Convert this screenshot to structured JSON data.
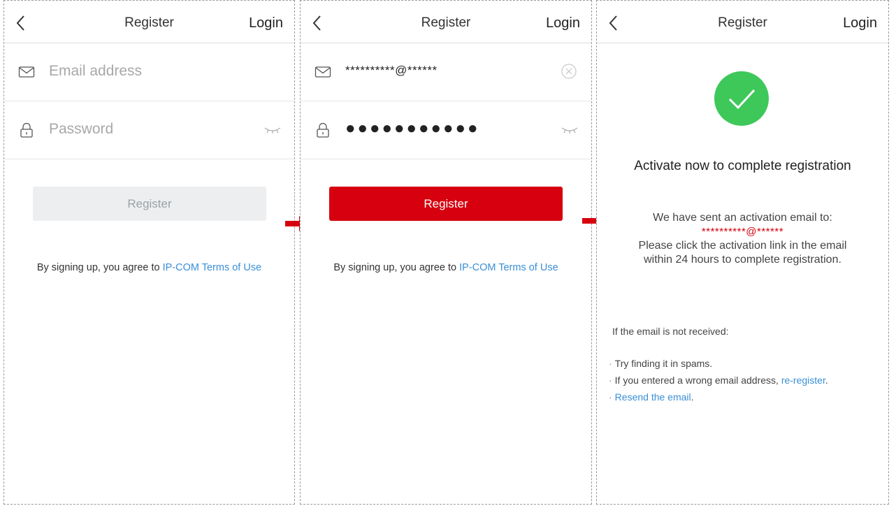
{
  "screens": [
    {
      "title": "Register",
      "login_label": "Login",
      "email_placeholder": "Email address",
      "password_placeholder": "Password",
      "register_label": "Register",
      "terms_text": "By signing up, you agree to ",
      "terms_link": "IP-COM Terms of Use"
    },
    {
      "title": "Register",
      "login_label": "Login",
      "email_value": "**********@******",
      "password_value": "●●●●●●●●●●●",
      "register_label": "Register",
      "terms_text": "By signing up, you agree to ",
      "terms_link": "IP-COM Terms of Use"
    },
    {
      "title": "Register",
      "login_label": "Login",
      "activate_title": "Activate now to complete registration",
      "sent_line": "We have sent an activation email to:",
      "sent_email": "**********@******",
      "instruction_1": "Please click the activation link in the email",
      "instruction_2": "within 24 hours to complete registration.",
      "help_heading": "If the email is not received:",
      "help_item_1": "Try finding it in spams.",
      "help_item_2_text": "If you entered a wrong email address, ",
      "help_item_2_link": "re-register",
      "help_item_2_end": ".",
      "help_item_3_link": "Resend the email",
      "help_item_3_end": "."
    }
  ],
  "icons": {
    "back": "chevron-left-icon",
    "email": "envelope-icon",
    "password": "lock-icon",
    "eye": "closed-eye-icon",
    "clear": "clear-circle-icon",
    "success": "check-circle-icon",
    "flow_arrow": "right-arrow-icon"
  },
  "colors": {
    "primary_red": "#d6000f",
    "link_blue": "#3a8fd6",
    "success_green": "#3ec85a",
    "disabled_bg": "#eceef0"
  }
}
